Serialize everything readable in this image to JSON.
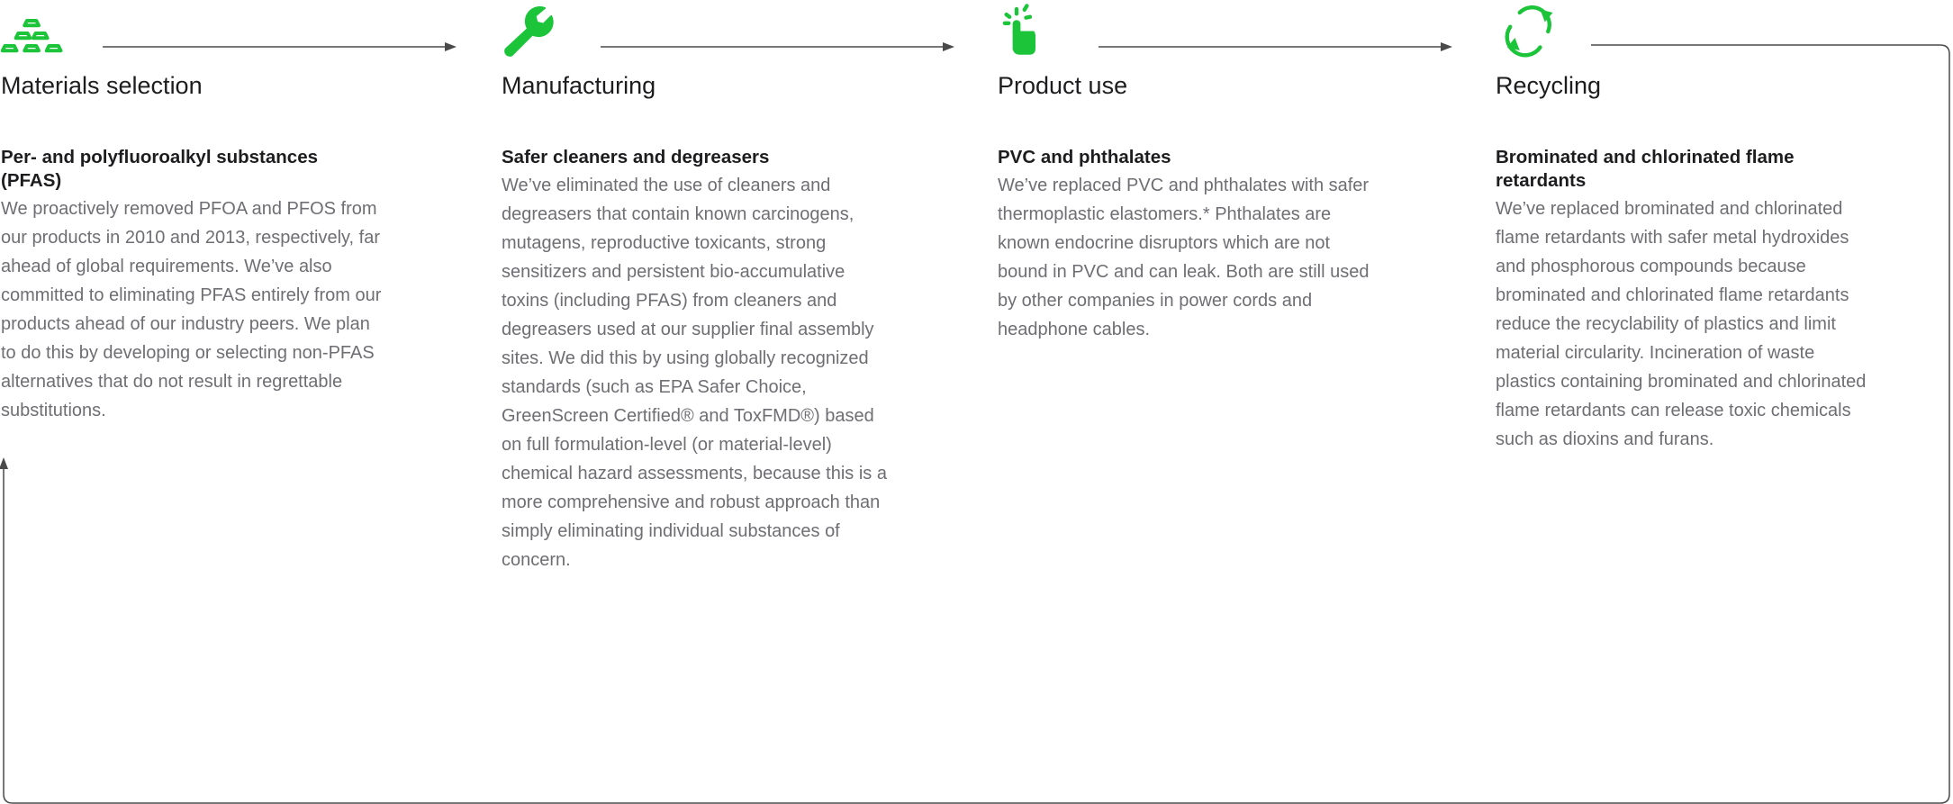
{
  "theme": {
    "accent_green": "#1cc43a",
    "line_color": "#4a4a4a",
    "title_color": "#1d1d1f",
    "body_color": "#6e6e73"
  },
  "stages": [
    {
      "icon": "gold-bars-icon",
      "title": "Materials selection",
      "heading": "Per- and polyfluoroalkyl substances (PFAS)",
      "body": "We proactively removed PFOA and PFOS from our products in 2010 and 2013, respectively, far ahead of global requirements. We’ve also committed to eliminating PFAS entirely from our products ahead of our industry peers. We plan to do this by developing or selecting non-PFAS alternatives that do not result in regrettable substitutions."
    },
    {
      "icon": "wrench-icon",
      "title": "Manufacturing",
      "heading": "Safer cleaners and degreasers",
      "body": "We’ve eliminated the use of cleaners and degreasers that contain known carcinogens, mutagens, reproductive toxicants, strong sensitizers and persistent bio-accumulative toxins (including PFAS) from cleaners and degreasers used at our supplier final assembly sites. We did this by using globally recognized standards (such as EPA Safer Choice, GreenScreen Certified® and ToxFMD®) based on full formulation-level (or material-level) chemical hazard assessments, because this is a more comprehensive and robust approach than simply eliminating individual substances of concern."
    },
    {
      "icon": "hand-tap-icon",
      "title": "Product use",
      "heading": "PVC and phthalates",
      "body": "We’ve replaced PVC and phthalates with safer thermoplastic elastomers.* Phthalates are known endocrine disruptors which are not bound in PVC and can leak. Both are still used by other companies in power cords and headphone cables."
    },
    {
      "icon": "recycle-arrows-icon",
      "title": "Recycling",
      "heading": "Brominated and chlorinated flame retardants",
      "body": "We’ve replaced brominated and chlorinated flame retardants with safer metal hydroxides and phosphorous compounds because brominated and chlorinated flame retardants reduce the recyclability of plastics and limit material circularity. Incineration of waste plastics containing brominated and chlorinated flame retardants can release toxic chemicals such as dioxins and furans."
    }
  ]
}
